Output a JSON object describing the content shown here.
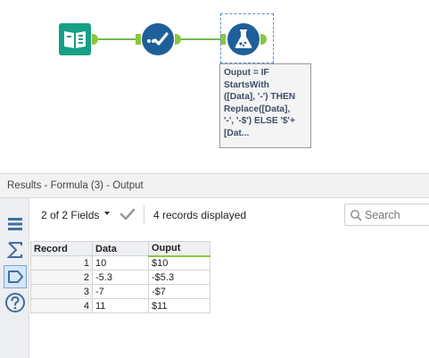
{
  "workflow": {
    "tools": [
      {
        "name": "input-data-tool",
        "icon": "book-icon",
        "color": "#16a085"
      },
      {
        "name": "select-tool",
        "icon": "checkmark-dots-icon",
        "color": "#1f5f9a"
      },
      {
        "name": "formula-tool",
        "icon": "flask-icon",
        "color": "#1f5f9a"
      }
    ],
    "annotation": "Ouput = IF\nStartsWith\n([Data], '-') THEN\nReplace([Data],\n'-', '-$') ELSE '$'+\n[Dat..."
  },
  "results": {
    "title": "Results - Formula (3) - Output",
    "fields_label": "2 of 2 Fields",
    "records_label": "4 records displayed",
    "search_placeholder": "Search",
    "side_toolbar_icons": [
      "list-icon",
      "sigma-icon",
      "tag-icon",
      "help-icon"
    ],
    "columns": [
      "Record",
      "Data",
      "Ouput"
    ],
    "rows": [
      {
        "record": "1",
        "data": "10",
        "ouput": "$10"
      },
      {
        "record": "2",
        "data": "-5.3",
        "ouput": "-$5.3"
      },
      {
        "record": "3",
        "data": "-7",
        "ouput": "-$7"
      },
      {
        "record": "4",
        "data": "11",
        "ouput": "$11"
      }
    ]
  },
  "colors": {
    "connection": "#74b94a",
    "input_tool": "#16a085",
    "select_tool": "#1f5f9a",
    "formula_tool": "#1f5f9a",
    "output_header_accent": "#8cc63f"
  }
}
